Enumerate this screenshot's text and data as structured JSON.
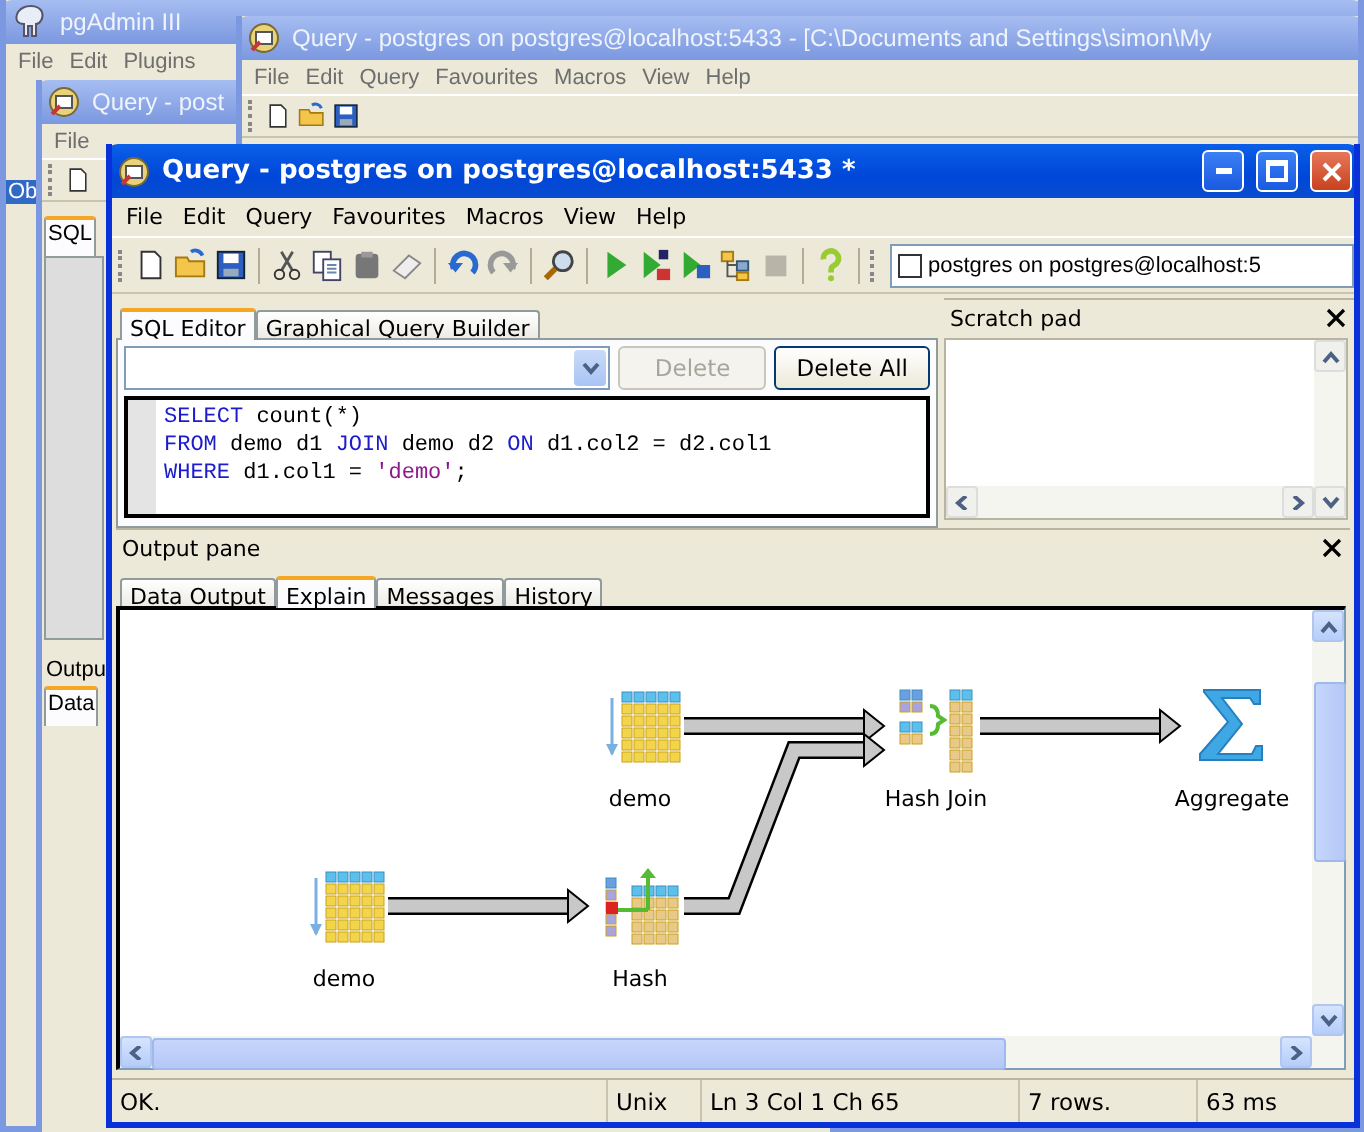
{
  "background_windows": [
    {
      "title": "pgAdmin III",
      "menu": [
        "File",
        "Edit",
        "Plugins"
      ],
      "tabs": [
        "Ob"
      ]
    },
    {
      "title": "Query - post",
      "menu": [
        "File"
      ],
      "tabs": [
        "SQL",
        "Outpu",
        "Data"
      ]
    },
    {
      "title": "Query - postgres on postgres@localhost:5433 - [C:\\Documents and Settings\\simon\\My",
      "menu": [
        "File",
        "Edit",
        "Query",
        "Favourites",
        "Macros",
        "View",
        "Help"
      ]
    }
  ],
  "window": {
    "title": "Query - postgres on postgres@localhost:5433 *"
  },
  "menu": [
    "File",
    "Edit",
    "Query",
    "Favourites",
    "Macros",
    "View",
    "Help"
  ],
  "toolbar": {
    "connection": "postgres on postgres@localhost:5"
  },
  "editor_tabs": [
    {
      "label": "SQL Editor",
      "selected": true
    },
    {
      "label": "Graphical Query Builder",
      "selected": false
    }
  ],
  "history_buttons": [
    {
      "label": "Delete",
      "disabled": true
    },
    {
      "label": "Delete All",
      "disabled": false
    }
  ],
  "sql_lines": [
    [
      {
        "text": "SELECT",
        "kind": "keyword"
      },
      {
        "text": " count(*)",
        "kind": "plain"
      }
    ],
    [
      {
        "text": "FROM",
        "kind": "keyword"
      },
      {
        "text": " demo d1 ",
        "kind": "plain"
      },
      {
        "text": "JOIN",
        "kind": "keyword"
      },
      {
        "text": " demo d2 ",
        "kind": "plain"
      },
      {
        "text": "ON",
        "kind": "keyword"
      },
      {
        "text": " d1.col2 = d2.col1",
        "kind": "plain"
      }
    ],
    [
      {
        "text": "WHERE",
        "kind": "keyword"
      },
      {
        "text": " d1.col1 = ",
        "kind": "plain"
      },
      {
        "text": "'demo'",
        "kind": "string"
      },
      {
        "text": ";",
        "kind": "plain"
      }
    ]
  ],
  "scratch_pad": {
    "title": "Scratch pad"
  },
  "output_pane": {
    "title": "Output pane",
    "tabs": [
      {
        "label": "Data Output",
        "selected": false
      },
      {
        "label": "Explain",
        "selected": true
      },
      {
        "label": "Messages",
        "selected": false
      },
      {
        "label": "History",
        "selected": false
      }
    ],
    "plan": {
      "label": "Aggregate",
      "kind": "aggregate",
      "children": [
        {
          "label": "Hash Join",
          "kind": "hashjoin",
          "children": [
            {
              "label": "demo",
              "kind": "scan"
            },
            {
              "label": "Hash",
              "kind": "hash",
              "children": [
                {
                  "label": "demo",
                  "kind": "scan"
                }
              ]
            }
          ]
        }
      ]
    }
  },
  "status_bar": [
    "OK.",
    "Unix",
    "Ln 3 Col 1 Ch 65",
    "7 rows.",
    "63 ms"
  ]
}
